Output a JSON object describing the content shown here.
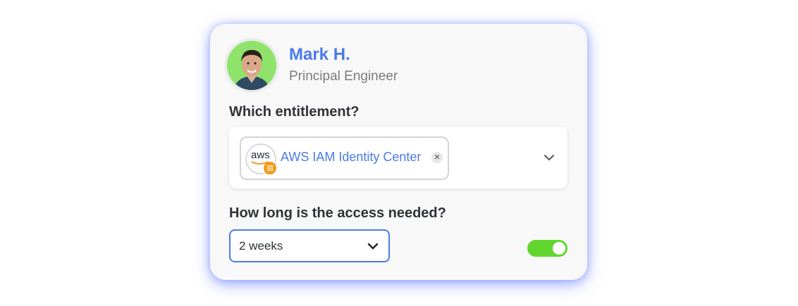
{
  "user": {
    "name": "Mark H.",
    "title": "Principal Engineer",
    "avatar_bg": "#8fe36a"
  },
  "entitlement": {
    "question": "Which entitlement?",
    "selected": [
      {
        "label": "AWS IAM Identity Center",
        "icon": "aws-logo-icon",
        "icon_text": "aws",
        "removable": true
      }
    ],
    "dropdown_icon": "chevron-down-icon"
  },
  "duration": {
    "question": "How long is the access needed?",
    "value": "2 weeks",
    "dropdown_icon": "chevron-down-icon"
  },
  "toggle": {
    "on": true,
    "color": "#62d62e"
  },
  "colors": {
    "accent": "#4a7bea",
    "glow": "#506eff"
  }
}
